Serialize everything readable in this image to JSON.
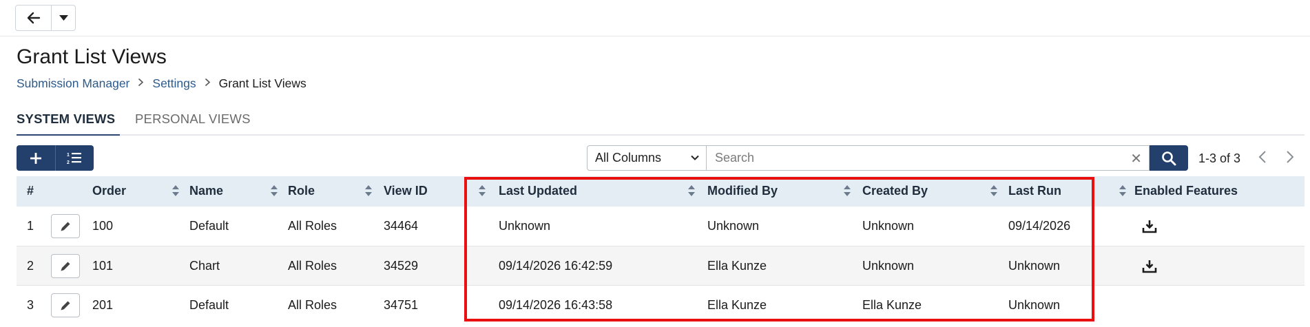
{
  "nav": {
    "back_icon": "arrow-left-icon",
    "menu_icon": "caret-down-icon"
  },
  "page": {
    "title": "Grant List Views",
    "breadcrumb": [
      "Submission Manager",
      "Settings",
      "Grant List Views"
    ]
  },
  "tabs": [
    {
      "label": "SYSTEM VIEWS",
      "active": true
    },
    {
      "label": "PERSONAL VIEWS",
      "active": false
    }
  ],
  "toolbar": {
    "add_icon": "plus-icon",
    "reorder_icon": "ordered-list-icon",
    "column_filter": "All Columns",
    "search_placeholder": "Search",
    "pager_text": "1-3 of 3"
  },
  "table": {
    "columns": [
      "#",
      "Order",
      "Name",
      "Role",
      "View ID",
      "Last Updated",
      "Modified By",
      "Created By",
      "Last Run",
      "Enabled Features"
    ],
    "rows": [
      {
        "num": "1",
        "order": "100",
        "name": "Default",
        "role": "All Roles",
        "view_id": "34464",
        "last_updated": "Unknown",
        "modified_by": "Unknown",
        "created_by": "Unknown",
        "last_run": "09/14/2026",
        "export": true
      },
      {
        "num": "2",
        "order": "101",
        "name": "Chart",
        "role": "All Roles",
        "view_id": "34529",
        "last_updated": "09/14/2026 16:42:59",
        "modified_by": "Ella Kunze",
        "created_by": "Unknown",
        "last_run": "Unknown",
        "export": true
      },
      {
        "num": "3",
        "order": "201",
        "name": "Default",
        "role": "All Roles",
        "view_id": "34751",
        "last_updated": "09/14/2026 16:43:58",
        "modified_by": "Ella Kunze",
        "created_by": "Ella Kunze",
        "last_run": "Unknown",
        "export": false
      }
    ]
  },
  "colors": {
    "primary": "#233f6b",
    "header_bg": "#e4edf3",
    "link": "#2b5a8c",
    "highlight": "#ea1010"
  }
}
